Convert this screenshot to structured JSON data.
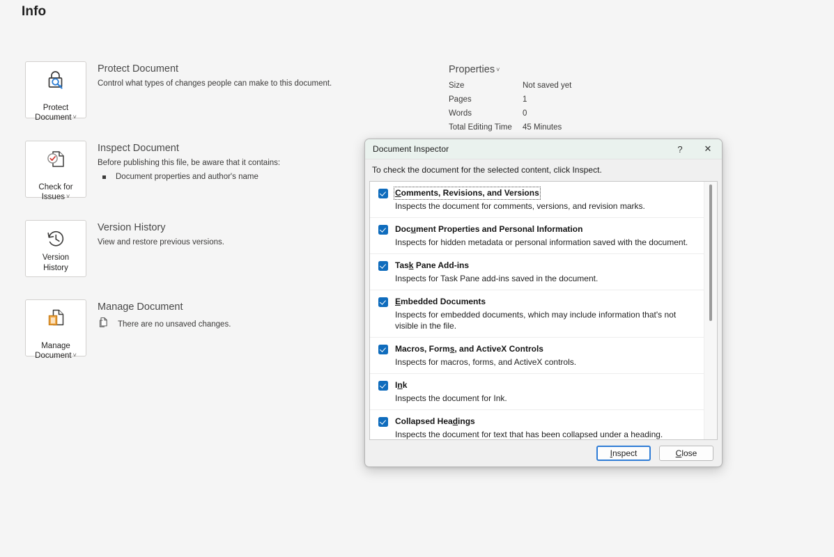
{
  "page": {
    "title": "Info"
  },
  "info_sections": [
    {
      "button_label": "Protect\nDocument",
      "button_has_caret": true,
      "icon": "padlock-magnifier-icon",
      "heading": "Protect Document",
      "description": "Control what types of changes people can make to this document.",
      "bullets": []
    },
    {
      "button_label": "Check for\nIssues",
      "button_has_caret": true,
      "icon": "document-check-icon",
      "heading": "Inspect Document",
      "description": "Before publishing this file, be aware that it contains:",
      "bullets": [
        "Document properties and author's name"
      ]
    },
    {
      "button_label": "Version\nHistory",
      "button_has_caret": false,
      "icon": "clock-history-icon",
      "heading": "Version History",
      "description": "View and restore previous versions.",
      "bullets": []
    },
    {
      "button_label": "Manage\nDocument",
      "button_has_caret": true,
      "icon": "document-pages-icon",
      "heading": "Manage Document",
      "description": "",
      "status_icon": "document-copy-icon",
      "status_text": "There are no unsaved changes.",
      "bullets": []
    }
  ],
  "properties": {
    "title": "Properties",
    "caret": "ˇ",
    "rows": [
      {
        "key": "Size",
        "value": "Not saved yet"
      },
      {
        "key": "Pages",
        "value": "1"
      },
      {
        "key": "Words",
        "value": "0"
      },
      {
        "key": "Total Editing Time",
        "value": "45 Minutes"
      }
    ]
  },
  "dialog": {
    "title": "Document Inspector",
    "help_glyph": "?",
    "close_glyph": "✕",
    "instruction": "To check the document for the selected content, click Inspect.",
    "items": [
      {
        "name": "Comments, Revisions, and Versions",
        "accel_index": 0,
        "checked": true,
        "focused": true,
        "description": "Inspects the document for comments, versions, and revision marks."
      },
      {
        "name": "Document Properties and Personal Information",
        "accel_index": 3,
        "checked": true,
        "focused": false,
        "description": "Inspects for hidden metadata or personal information saved with the document."
      },
      {
        "name": "Task Pane Add-ins",
        "accel_index": 3,
        "checked": true,
        "focused": false,
        "description": "Inspects for Task Pane add-ins saved in the document."
      },
      {
        "name": "Embedded Documents",
        "accel_index": 0,
        "checked": true,
        "focused": false,
        "description": "Inspects for embedded documents, which may include information that's not visible in the file."
      },
      {
        "name": "Macros, Forms, and ActiveX Controls",
        "accel_index": 12,
        "checked": true,
        "focused": false,
        "description": "Inspects for macros, forms, and ActiveX controls."
      },
      {
        "name": "Ink",
        "accel_index": 1,
        "checked": true,
        "focused": false,
        "description": "Inspects the document for Ink."
      },
      {
        "name": "Collapsed Headings",
        "accel_index": 13,
        "checked": true,
        "focused": false,
        "description": "Inspects the document for text that has been collapsed under a heading."
      }
    ],
    "buttons": [
      {
        "label": "Inspect",
        "accel_index": 0,
        "default": true
      },
      {
        "label": "Close",
        "accel_index": 0,
        "default": false
      }
    ]
  },
  "colors": {
    "page_background": "#f5f5f5",
    "accent_blue": "#0f6cbd",
    "default_button_border": "#2e7cd6",
    "dialog_titlebar": "#eaf2ee",
    "dialog_body": "#f0f0f0",
    "manage_orange": "#e8a33d",
    "check_red": "#d0342c"
  }
}
